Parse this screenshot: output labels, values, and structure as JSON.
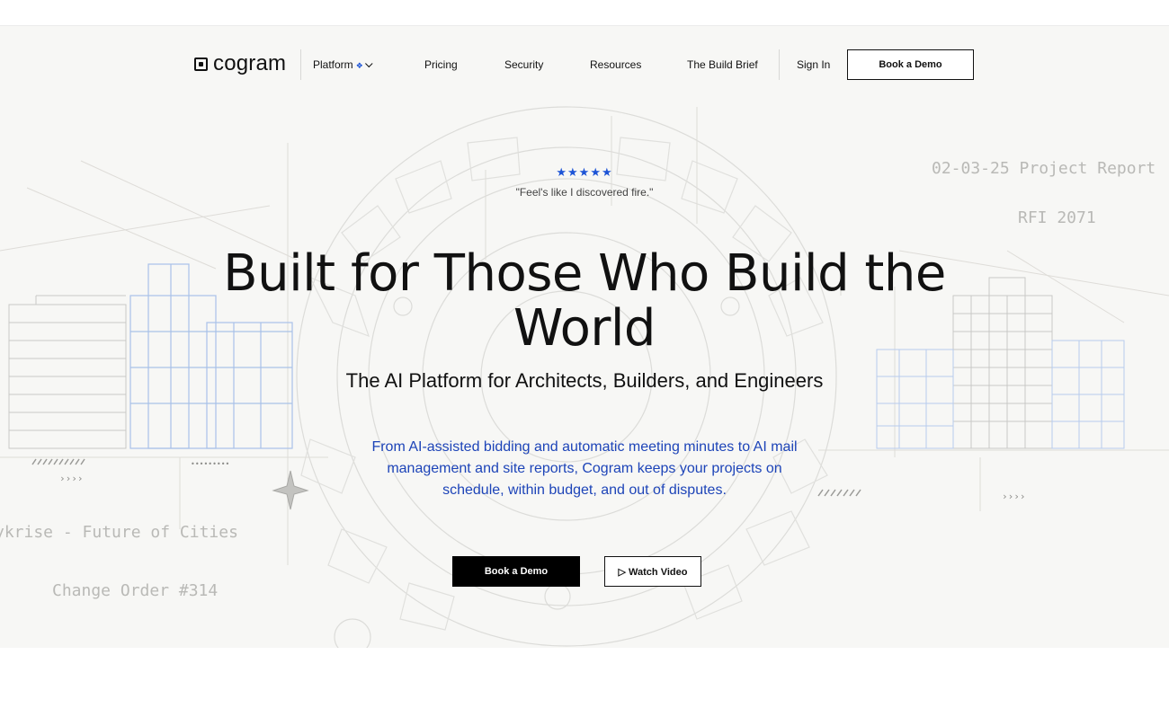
{
  "brand": {
    "name": "cogram"
  },
  "nav": {
    "platform": "Platform",
    "platform_marker": "❖",
    "pricing": "Pricing",
    "security": "Security",
    "resources": "Resources",
    "build_brief": "The Build Brief",
    "sign_in": "Sign In",
    "book_demo": "Book a Demo"
  },
  "hero": {
    "rating_stars": "★★★★★",
    "rating": 5,
    "quote": "\"Feel's like I discovered fire.\"",
    "title": "Built for Those Who Build the World",
    "subtitle": "The AI Platform for Architects, Builders, and Engineers",
    "description": "From AI-assisted bidding and automatic meeting minutes to AI mail management and site reports, Cogram keeps your projects on schedule, within budget, and out of disputes.",
    "cta_primary": "Book a Demo",
    "cta_video": "▷ Watch Video"
  },
  "background_labels": {
    "project_report": "02-03-25 Project Report",
    "rfi": "RFI 2071",
    "future_cities": "ykrise - Future of Cities",
    "change_order": "Change Order #314",
    "arrows": "››››",
    "dots": "•••••••••"
  },
  "colors": {
    "accent": "#1d54d6",
    "background": "#f7f7f5",
    "text": "#111111"
  }
}
